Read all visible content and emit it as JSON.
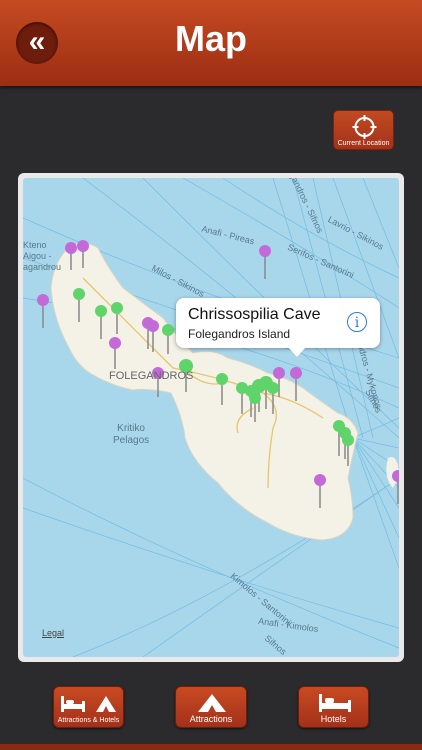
{
  "header": {
    "title": "Map",
    "back_label": "«"
  },
  "current_location": {
    "label": "Current Location"
  },
  "map": {
    "labels": {
      "place_west": "Kteno\nAigou -\nagandrou",
      "town": "FOLEGANDROS",
      "kritiko": "Kritiko\nPelagos",
      "route1": "Anafi - Pireas",
      "route2": "Serifos - Santorini",
      "route3": "Lavrio - Sikinos",
      "route4": "Milos - Sikinos",
      "route5": "Folegandros - Sifnos",
      "route6": "Kimolos - Santorini",
      "route7": "Anafi - Kimolos",
      "route8": "Folegandros - Mykonos",
      "route9": "Sifnos",
      "route10": "Sifnos"
    },
    "legal": "Legal"
  },
  "callout": {
    "title": "Chrissospilia Cave",
    "subtitle": "Folegandros Island",
    "info_icon": "ⓘ"
  },
  "tabs": [
    {
      "label": "Attractions & Hotels"
    },
    {
      "label": "Attractions"
    },
    {
      "label": "Hotels"
    }
  ],
  "colors": {
    "accent": "#b53c1c",
    "pin_green": "#5fd46b",
    "pin_purple": "#c36ad8",
    "sea": "#a8d7ec",
    "land": "#f4f1e6"
  }
}
